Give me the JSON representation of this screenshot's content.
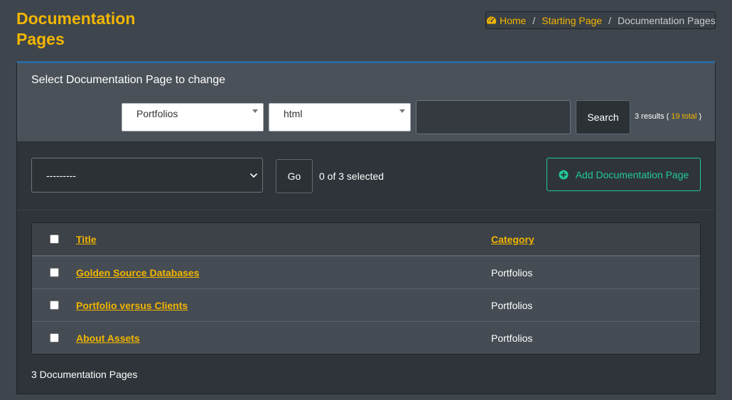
{
  "page": {
    "title": "Documentation Pages"
  },
  "breadcrumb": {
    "home": "Home",
    "starting": "Starting Page",
    "current": "Documentation Pages",
    "separator": "/"
  },
  "filter": {
    "heading": "Select Documentation Page to change",
    "category_value": "Portfolios",
    "type_value": "html",
    "search_value": "",
    "search_label": "Search",
    "results_prefix": "3 results (",
    "results_total": "19 total",
    "results_suffix": ")"
  },
  "actions": {
    "select_value": "---------",
    "go_label": "Go",
    "selected_count": "0 of 3 selected",
    "add_label": "Add Documentation Page"
  },
  "table": {
    "columns": [
      "Title",
      "Category"
    ],
    "rows": [
      {
        "title": "Golden Source Databases",
        "category": "Portfolios"
      },
      {
        "title": "Portfolio versus Clients",
        "category": "Portfolios"
      },
      {
        "title": "About Assets",
        "category": "Portfolios"
      }
    ]
  },
  "footer": {
    "count": "3 Documentation Pages"
  },
  "colors": {
    "accent": "#f2b600",
    "success": "#20c997",
    "header_border": "#2d6a9c"
  }
}
